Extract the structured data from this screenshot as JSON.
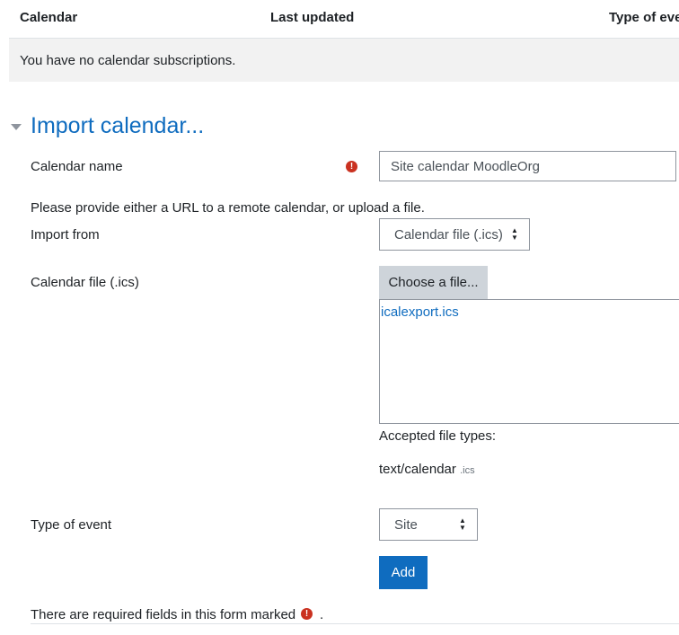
{
  "table": {
    "headers": [
      "Calendar",
      "Last updated",
      "Type of eve"
    ],
    "empty_message": "You have no calendar subscriptions."
  },
  "section": {
    "title": "Import calendar..."
  },
  "form": {
    "calendar_name_label": "Calendar name",
    "calendar_name_value": "Site calendar MoodleOrg",
    "help_text": "Please provide either a URL to a remote calendar, or upload a file.",
    "import_from_label": "Import from",
    "import_from_selected": "Calendar file (.ics)",
    "calendar_file_label": "Calendar file (.ics)",
    "choose_file_label": "Choose a file...",
    "uploaded_file": "icalexport.ics",
    "accepted_types_label": "Accepted file types:",
    "accepted_mime": "text/calendar",
    "accepted_ext": ".ics",
    "event_type_label": "Type of event",
    "event_type_selected": "Site",
    "submit_label": "Add",
    "required_note": "There are required fields in this form marked",
    "required_note_end": "."
  },
  "icons": {
    "required": "exclamation-circle-icon",
    "collapse": "caret-down-icon",
    "select_arrows": "sort-updown-icon"
  },
  "colors": {
    "link": "#0f6cbf",
    "primary": "#0f6cbf",
    "required": "#ca3120",
    "row_bg": "#f2f2f2"
  }
}
